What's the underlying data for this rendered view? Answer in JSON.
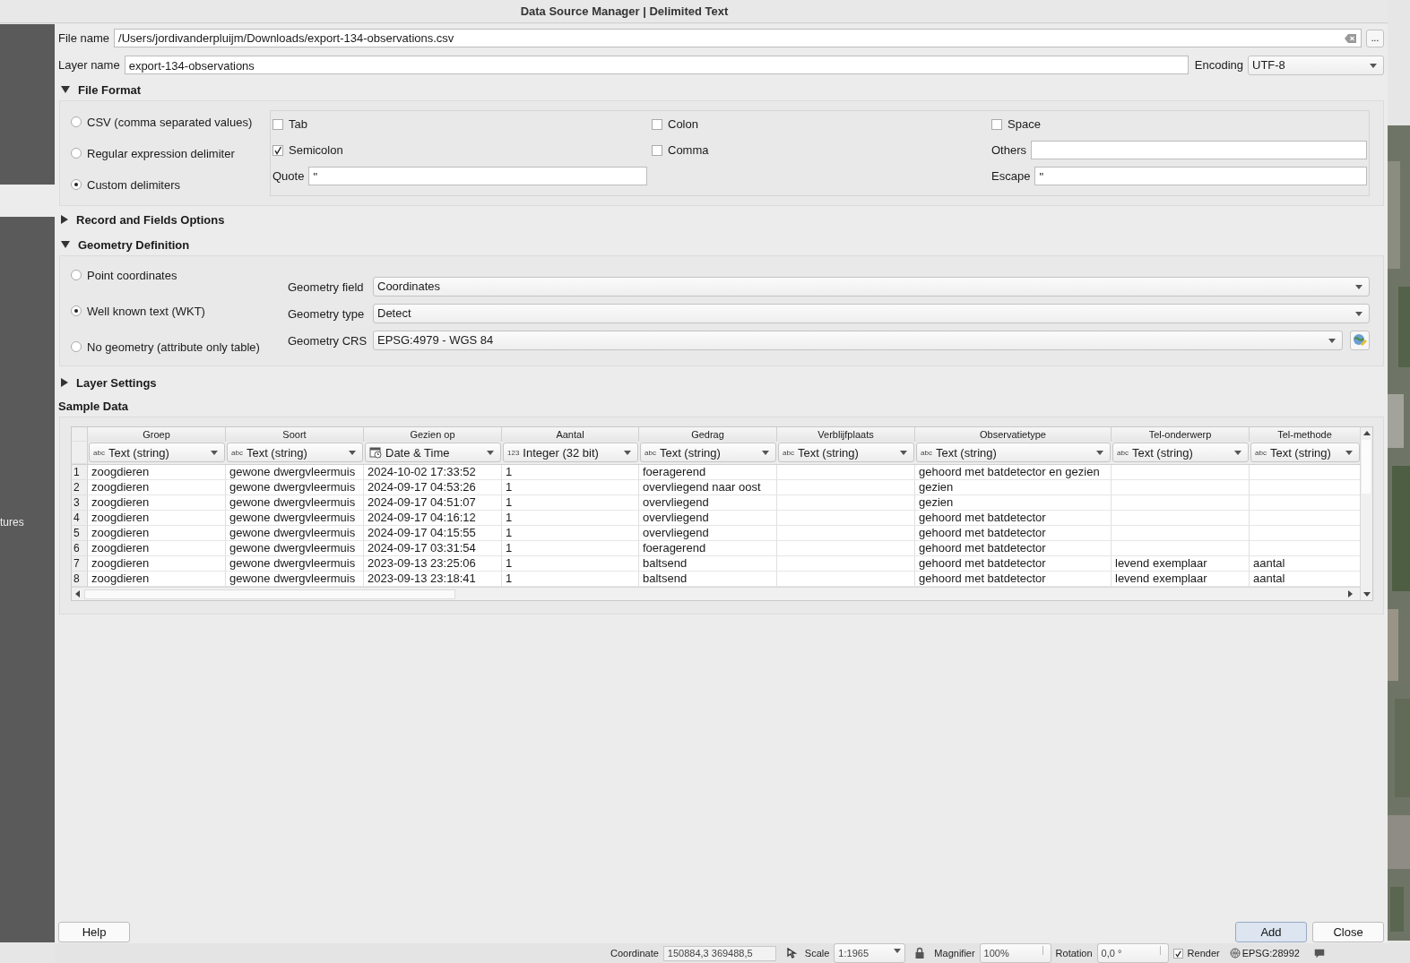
{
  "window": {
    "title": "Data Source Manager | Delimited Text"
  },
  "background": {
    "sidebar_text": "tures"
  },
  "file_name": {
    "label": "File name",
    "value": "/Users/jordivanderpluijm/Downloads/export-134-observations.csv",
    "browse": "..."
  },
  "layer_name": {
    "label": "Layer name",
    "value": "export-134-observations"
  },
  "encoding": {
    "label": "Encoding",
    "value": "UTF-8"
  },
  "file_format": {
    "title": "File Format",
    "expanded": true,
    "formats": [
      {
        "label": "CSV (comma separated values)",
        "selected": false
      },
      {
        "label": "Regular expression delimiter",
        "selected": false
      },
      {
        "label": "Custom delimiters",
        "selected": true
      }
    ],
    "delimiters": [
      {
        "label": "Tab",
        "checked": false
      },
      {
        "label": "Colon",
        "checked": false
      },
      {
        "label": "Space",
        "checked": false
      },
      {
        "label": "Semicolon",
        "checked": true
      },
      {
        "label": "Comma",
        "checked": false
      }
    ],
    "others": {
      "label": "Others"
    },
    "quote": {
      "label": "Quote",
      "value": "\""
    },
    "escape": {
      "label": "Escape",
      "value": "\""
    }
  },
  "record_fields_options": {
    "title": "Record and Fields Options",
    "expanded": false
  },
  "geometry_definition": {
    "title": "Geometry Definition",
    "expanded": true,
    "options": [
      {
        "label": "Point coordinates",
        "selected": false
      },
      {
        "label": "Well known text (WKT)",
        "selected": true
      },
      {
        "label": "No geometry (attribute only table)",
        "selected": false
      }
    ],
    "geometry_field": {
      "label": "Geometry field",
      "value": "Coordinates"
    },
    "geometry_type": {
      "label": "Geometry type",
      "value": "Detect"
    },
    "geometry_crs": {
      "label": "Geometry CRS",
      "value": "EPSG:4979 - WGS 84"
    }
  },
  "layer_settings": {
    "title": "Layer Settings",
    "expanded": false
  },
  "sample_data": {
    "title": "Sample Data",
    "columns": [
      {
        "name": "Groep",
        "type": "Text (string)",
        "kind": "text",
        "icon_text": "abc"
      },
      {
        "name": "Soort",
        "type": "Text (string)",
        "kind": "text",
        "icon_text": "abc"
      },
      {
        "name": "Gezien op",
        "type": "Date & Time",
        "kind": "datetime"
      },
      {
        "name": "Aantal",
        "type": "Integer (32 bit)",
        "kind": "integer",
        "icon_text": "123"
      },
      {
        "name": "Gedrag",
        "type": "Text (string)",
        "kind": "text",
        "icon_text": "abc"
      },
      {
        "name": "Verblijfplaats",
        "type": "Text (string)",
        "kind": "text",
        "icon_text": "abc"
      },
      {
        "name": "Observatietype",
        "type": "Text (string)",
        "kind": "text",
        "icon_text": "abc"
      },
      {
        "name": "Tel-onderwerp",
        "type": "Text (string)",
        "kind": "text",
        "icon_text": "abc"
      },
      {
        "name": "Tel-methode",
        "type": "Text (string)",
        "kind": "text",
        "icon_text": "abc"
      }
    ],
    "rows": [
      {
        "number": "1",
        "cells": [
          "zoogdieren",
          "gewone dwergvleermuis",
          "2024-10-02 17:33:52",
          "1",
          "foeragerend",
          "",
          "gehoord met batdetector en gezien",
          "",
          ""
        ]
      },
      {
        "number": "2",
        "cells": [
          "zoogdieren",
          "gewone dwergvleermuis",
          "2024-09-17 04:53:26",
          "1",
          "overvliegend naar oost",
          "",
          "gezien",
          "",
          ""
        ]
      },
      {
        "number": "3",
        "cells": [
          "zoogdieren",
          "gewone dwergvleermuis",
          "2024-09-17 04:51:07",
          "1",
          "overvliegend",
          "",
          "gezien",
          "",
          ""
        ]
      },
      {
        "number": "4",
        "cells": [
          "zoogdieren",
          "gewone dwergvleermuis",
          "2024-09-17 04:16:12",
          "1",
          "overvliegend",
          "",
          "gehoord met batdetector",
          "",
          ""
        ]
      },
      {
        "number": "5",
        "cells": [
          "zoogdieren",
          "gewone dwergvleermuis",
          "2024-09-17 04:15:55",
          "1",
          "overvliegend",
          "",
          "gehoord met batdetector",
          "",
          ""
        ]
      },
      {
        "number": "6",
        "cells": [
          "zoogdieren",
          "gewone dwergvleermuis",
          "2024-09-17 03:31:54",
          "1",
          "foeragerend",
          "",
          "gehoord met batdetector",
          "",
          ""
        ]
      },
      {
        "number": "7",
        "cells": [
          "zoogdieren",
          "gewone dwergvleermuis",
          "2023-09-13 23:25:06",
          "1",
          "baltsend",
          "",
          "gehoord met batdetector",
          "levend exemplaar",
          "aantal"
        ]
      },
      {
        "number": "8",
        "cells": [
          "zoogdieren",
          "gewone dwergvleermuis",
          "2023-09-13 23:18:41",
          "1",
          "baltsend",
          "",
          "gehoord met batdetector",
          "levend exemplaar",
          "aantal"
        ]
      }
    ]
  },
  "help_button": {
    "label": "Help"
  },
  "action_buttons": [
    {
      "label": "Add",
      "default": true
    },
    {
      "label": "Close",
      "default": false
    }
  ],
  "status_bar": {
    "coordinate_label": "Coordinate",
    "coordinate": "150884,3  369488,5",
    "scale_label": "Scale",
    "scale": "1:1965",
    "magnifier_label": "Magnifier",
    "magnifier": "100%",
    "rotation_label": "Rotation",
    "rotation": "0,0 °",
    "render": {
      "label": "Render",
      "checked": true
    },
    "crs": "EPSG:28992"
  }
}
